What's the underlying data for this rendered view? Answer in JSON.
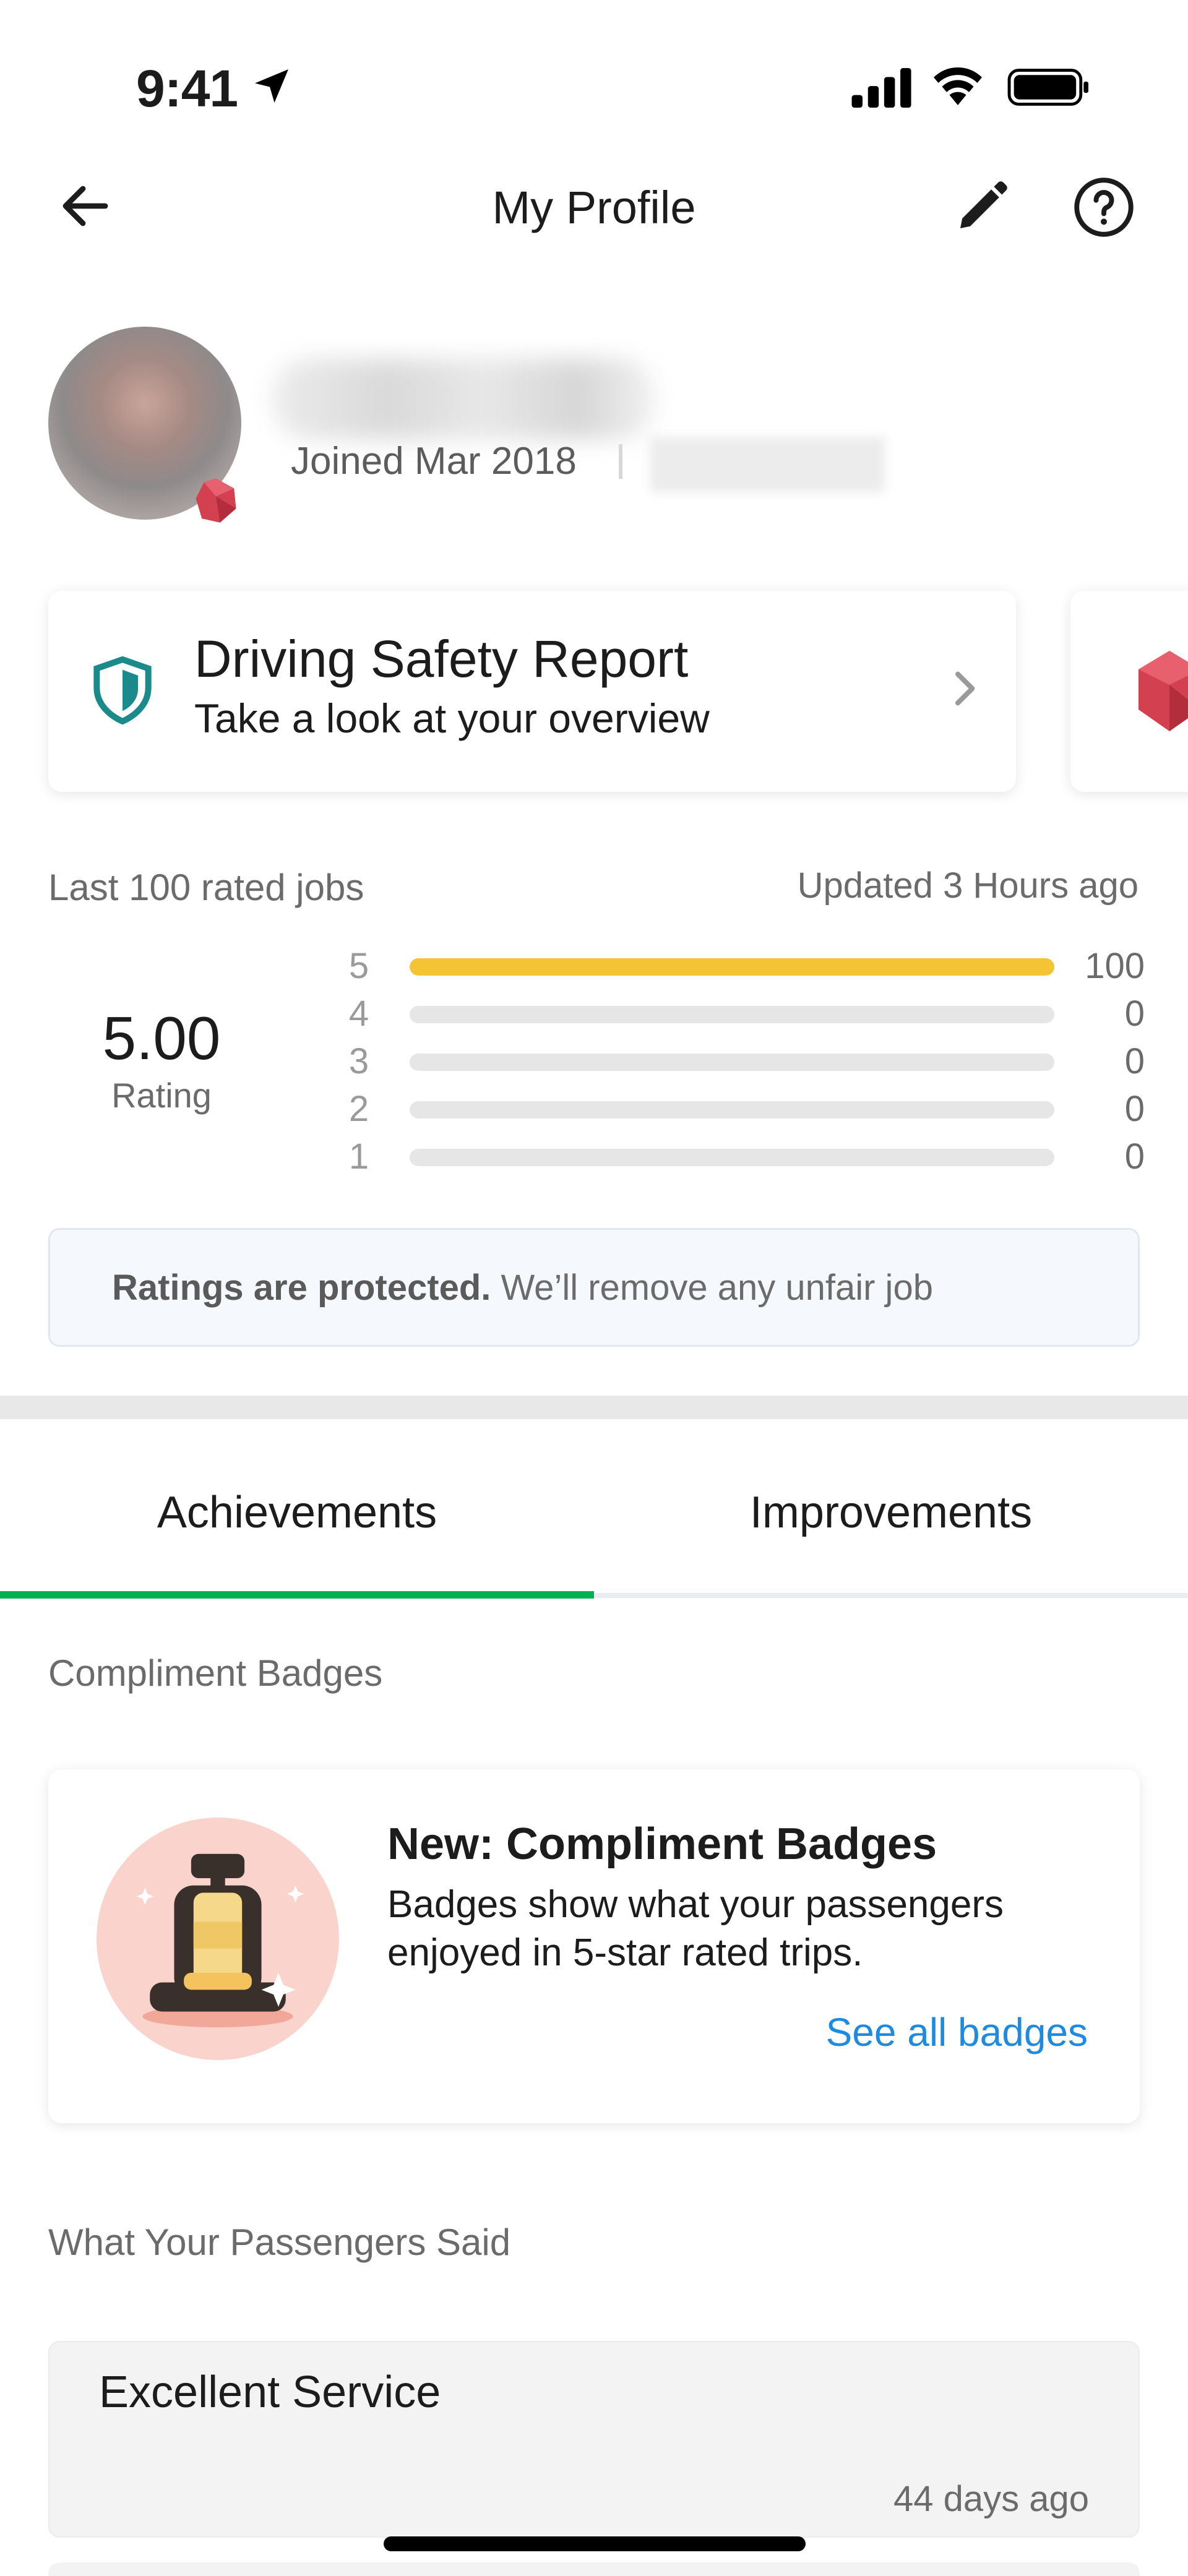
{
  "status_bar": {
    "time": "9:41",
    "icons": [
      "location-arrow-icon",
      "signal-icon",
      "wifi-icon",
      "battery-icon"
    ]
  },
  "header": {
    "title": "My Profile",
    "icons": [
      "back-arrow-icon",
      "edit-pencil-icon",
      "help-icon"
    ]
  },
  "profile": {
    "joined": "Joined Mar 2018"
  },
  "safety_card": {
    "title": "Driving Safety Report",
    "subtitle": "Take a look at your overview",
    "accent_color": "#1a8a8a"
  },
  "ratings": {
    "label": "Last 100 rated jobs",
    "updated": "Updated 3 Hours ago",
    "value": "5.00",
    "caption": "Rating",
    "bar_color": "#f4c434",
    "bars": [
      {
        "star": "5",
        "count": "100",
        "fraction": 1.0
      },
      {
        "star": "4",
        "count": "0",
        "fraction": 0
      },
      {
        "star": "3",
        "count": "0",
        "fraction": 0
      },
      {
        "star": "2",
        "count": "0",
        "fraction": 0
      },
      {
        "star": "1",
        "count": "0",
        "fraction": 0
      }
    ],
    "protected_bold": "Ratings are protected.",
    "protected_rest": " We’ll remove any unfair job"
  },
  "tabs": [
    {
      "label": "Achievements",
      "active": true
    },
    {
      "label": "Improvements",
      "active": false
    }
  ],
  "tab_accent_color": "#00b14f",
  "compliments": {
    "heading": "Compliment Badges",
    "card_title": "New: Compliment Badges",
    "card_description": "Badges show what your passengers enjoyed in 5-star rated trips.",
    "link": "See all badges",
    "link_color": "#1f8be0"
  },
  "passengers": {
    "heading": "What Your Passengers Said",
    "reviews": [
      {
        "text": "Excellent Service",
        "date": "44 days ago"
      }
    ]
  }
}
